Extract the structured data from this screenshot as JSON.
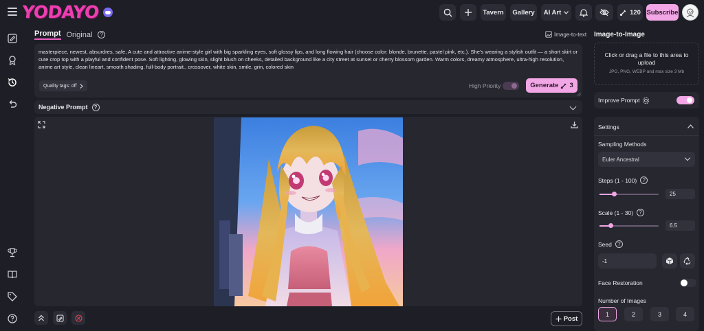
{
  "app": {
    "logo": "YODAYO"
  },
  "header": {
    "nav": [
      {
        "label": "Tavern"
      },
      {
        "label": "Gallery"
      },
      {
        "label": "AI Art"
      }
    ],
    "credits": "120",
    "subscribe_label": "Subscribe"
  },
  "main": {
    "tabs": {
      "prompt": "Prompt",
      "original": "Original"
    },
    "image_to_text": "Image-to-text",
    "prompt_text": "masterpiece, newest, absurdres, safe, A cute and attractive anime-style girl with big sparkling eyes, soft glossy lips, and long flowing hair (choose color: blonde, brunette, pastel pink, etc.). She's wearing a stylish outfit — a short skirt or cute crop top with a playful and confident pose. Soft lighting, glowing skin, slight blush on cheeks, detailed background like a city street at sunset or cherry blossom garden. Warm colors, dreamy atmosphere, ultra-high resolution, anime art style, clean lineart, smooth shading, full-body portrait.,  crossover, white skin, smile, grin, colored skin",
    "quality_tags": "Quality tags: off",
    "high_priority": "High Priority",
    "generate_label": "Generate",
    "generate_cost": "3",
    "negative_prompt": "Negative Prompt",
    "post_label": "Post"
  },
  "panel": {
    "title": "Image-to-Image",
    "upload_text": "Click or drag a file to this area to upload",
    "upload_hint": "JPG, PNG, WEBP and max size 3 Mb",
    "improve_prompt": "Improve Prompt",
    "improve_prompt_on": true,
    "settings_title": "Settings",
    "sampling_label": "Sampling Methods",
    "sampling_value": "Euler Ancestral",
    "steps_label": "Steps (1 - 100)",
    "steps_value": "25",
    "steps_fraction": 0.24,
    "scale_label": "Scale (1 - 30)",
    "scale_value": "6.5",
    "scale_fraction": 0.19,
    "seed_label": "Seed",
    "seed_value": "-1",
    "face_restoration_label": "Face Restoration",
    "face_restoration_on": false,
    "num_images_label": "Number of Images",
    "num_images_options": [
      "1",
      "2",
      "3",
      "4"
    ],
    "num_images_selected": "1"
  },
  "colors": {
    "accent": "#f3a6e6",
    "brand": "#ec3fb0",
    "background": "#1e1f26",
    "card": "#26272f"
  }
}
